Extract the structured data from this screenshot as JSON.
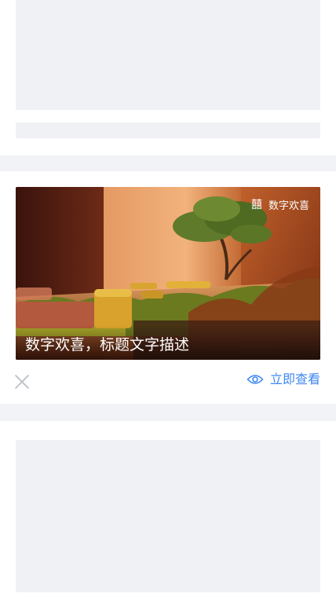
{
  "card": {
    "brand_mark": "囍",
    "brand_name": "数字欢喜",
    "caption": "数字欢喜，标题文字描述",
    "view_label": "立即查看",
    "close_icon": "close-icon",
    "eye_icon": "eye-icon"
  },
  "colors": {
    "accent": "#3e87f0",
    "separator": "#f2f3f7",
    "skeleton": "#f0f1f5"
  }
}
